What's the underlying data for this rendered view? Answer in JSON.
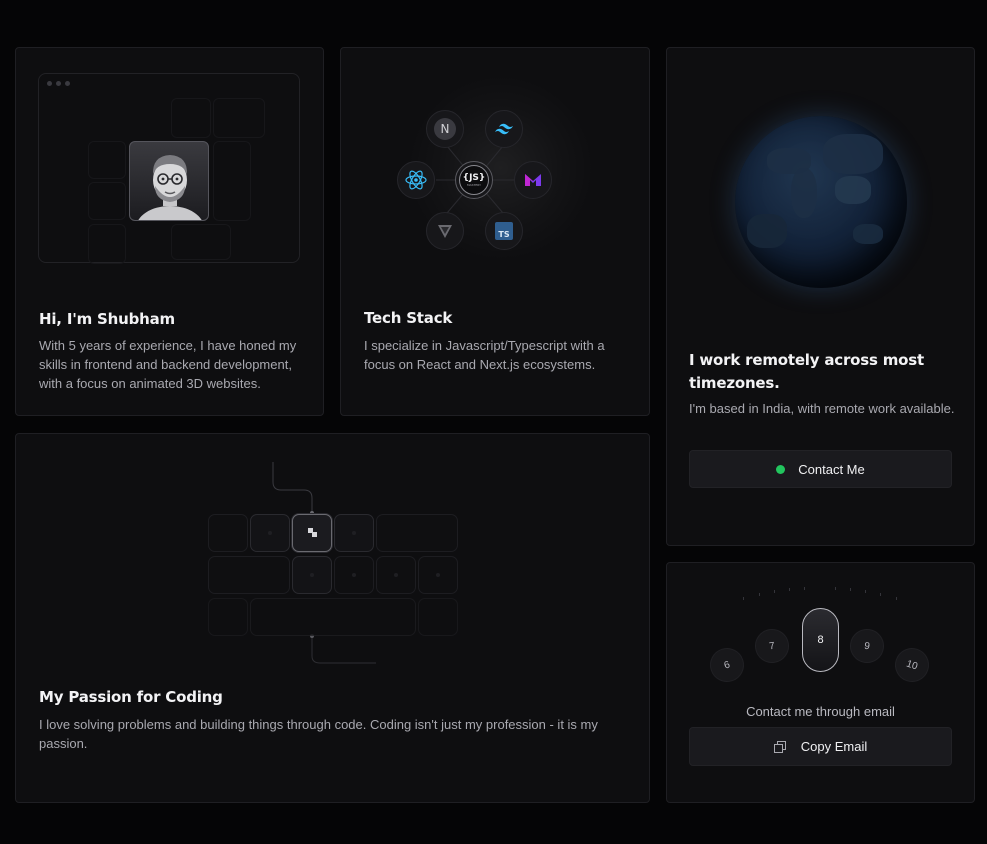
{
  "cards": {
    "intro": {
      "title": "Hi, I'm Shubham",
      "description": "With 5 years of experience, I have honed my skills in frontend and backend development, with a focus on animated 3D websites."
    },
    "tech": {
      "title": "Tech Stack",
      "description": "I specialize in Javascript/Typescript with a focus on React and Next.js ecosystems.",
      "icons": [
        {
          "name": "nextjs-icon",
          "label": "N"
        },
        {
          "name": "tailwind-icon",
          "label": ""
        },
        {
          "name": "react-icon",
          "label": ""
        },
        {
          "name": "javascript-mastery-icon",
          "label": "{JS}",
          "sublabel": "MASTERY"
        },
        {
          "name": "framer-icon",
          "label": ""
        },
        {
          "name": "vite-icon",
          "label": ""
        },
        {
          "name": "typescript-icon",
          "label": "TS"
        }
      ]
    },
    "remote": {
      "title": "I work remotely across most timezones.",
      "description": "I'm based in India, with remote work available.",
      "contact_button": "Contact Me"
    },
    "passion": {
      "title": "My Passion for Coding",
      "description": "I love solving problems and building things through code. Coding isn't just my profession - it is my passion."
    },
    "email": {
      "caption": "Contact me through email",
      "copy_button": "Copy Email",
      "dial_numbers": [
        "6",
        "7",
        "8",
        "9",
        "10"
      ],
      "selected": "8"
    }
  },
  "colors": {
    "background": "#050506",
    "card": "#0e0e10",
    "accent_green": "#22c55e"
  }
}
